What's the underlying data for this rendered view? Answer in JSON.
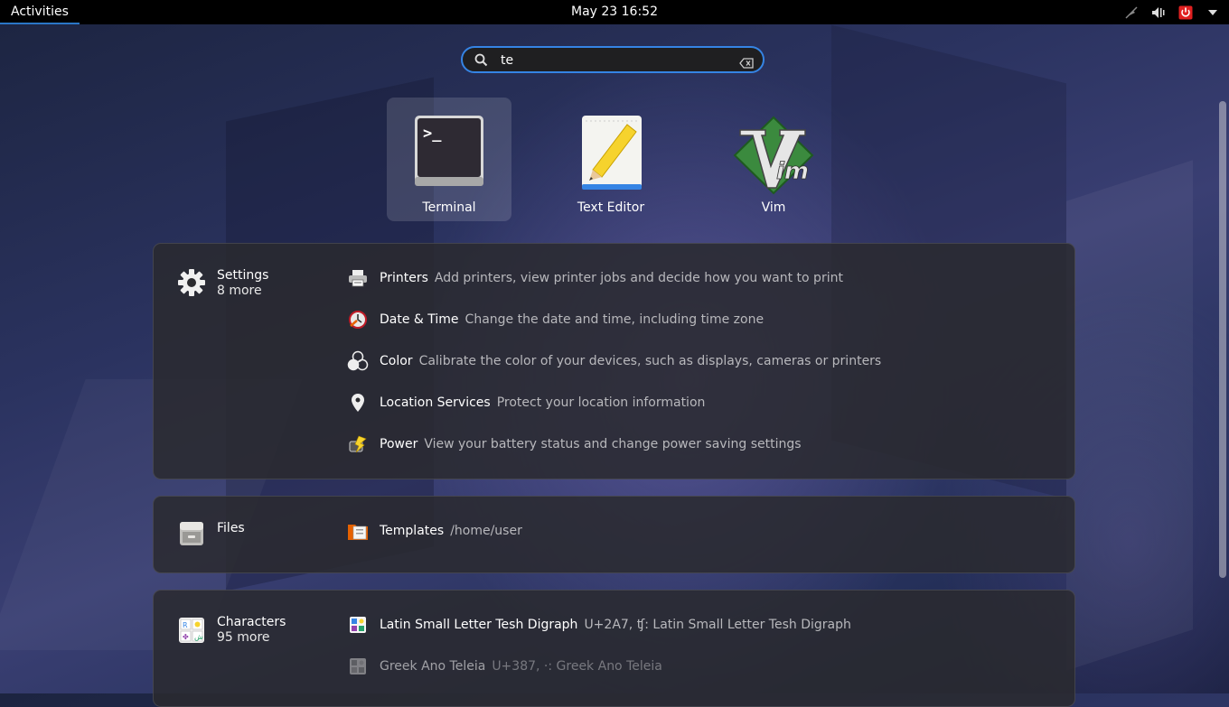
{
  "topbar": {
    "activities": "Activities",
    "clock": "May 23  16:52",
    "tray_icons": [
      "network-icon",
      "volume-icon",
      "power-icon",
      "system-menu-chevron-icon"
    ]
  },
  "search": {
    "value": "te",
    "placeholder": ""
  },
  "apps": [
    {
      "label": "Terminal",
      "icon": "terminal-icon",
      "selected": true
    },
    {
      "label": "Text Editor",
      "icon": "text-editor-icon",
      "selected": false
    },
    {
      "label": "Vim",
      "icon": "vim-icon",
      "selected": false
    }
  ],
  "providers": {
    "settings": {
      "name": "Settings",
      "more": "8 more",
      "results": [
        {
          "title": "Printers",
          "description": "Add printers, view printer jobs and decide how you want to print"
        },
        {
          "title": "Date & Time",
          "description": "Change the date and time, including time zone"
        },
        {
          "title": "Color",
          "description": "Calibrate the color of your devices, such as displays, cameras or printers"
        },
        {
          "title": "Location Services",
          "description": "Protect your location information"
        },
        {
          "title": "Power",
          "description": "View your battery status and change power saving settings"
        }
      ]
    },
    "files": {
      "name": "Files",
      "results": [
        {
          "title": "Templates",
          "description": "/home/user"
        }
      ]
    },
    "characters": {
      "name": "Characters",
      "more": "95 more",
      "results": [
        {
          "title": "Latin Small Letter Tesh Digraph",
          "description": "U+2A7, ʧ: Latin Small Letter Tesh Digraph"
        },
        {
          "title": "Greek Ano Teleia",
          "description": "U+387, ·: Greek Ano Teleia"
        }
      ]
    }
  },
  "colors": {
    "accent": "#3584e4",
    "topbar": "#000000",
    "panel": "#2a2a2e"
  }
}
